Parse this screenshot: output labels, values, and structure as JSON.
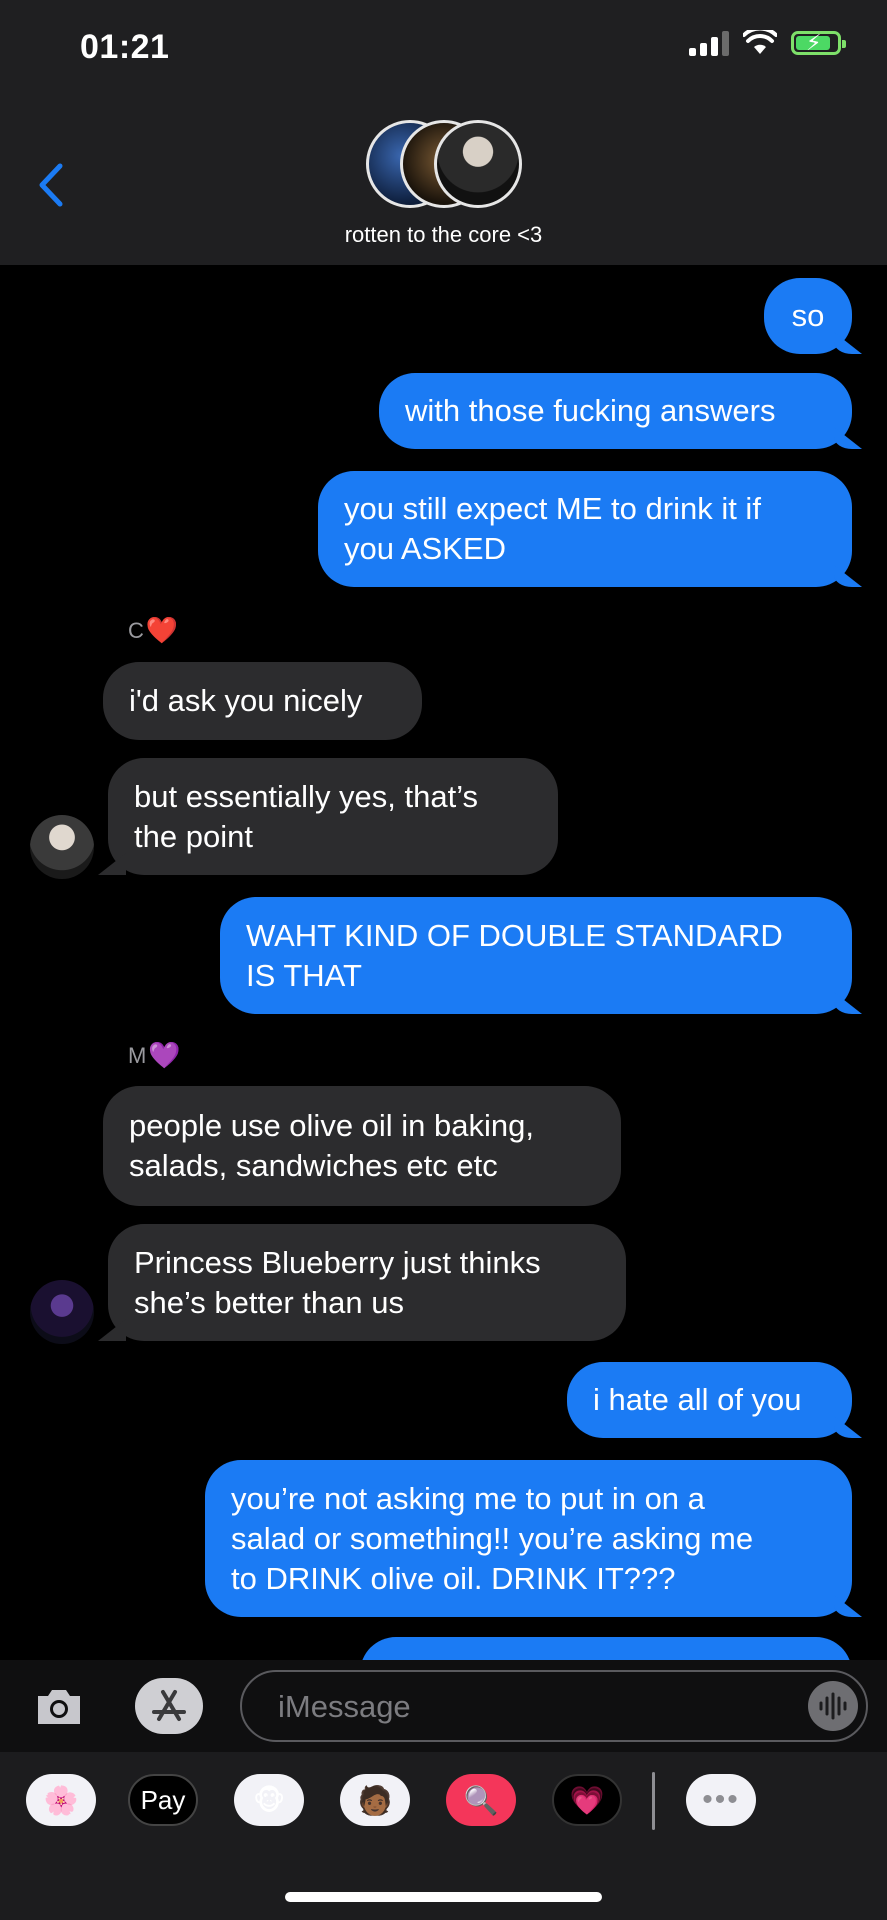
{
  "status": {
    "time": "01:21"
  },
  "header": {
    "group_name": "rotten to the core <3"
  },
  "senders": {
    "c": "C",
    "m": "M"
  },
  "messages": [
    {
      "id": "m1",
      "lines": [
        "so"
      ]
    },
    {
      "id": "m2",
      "lines": [
        "with those fucking answers"
      ]
    },
    {
      "id": "m3",
      "lines": [
        "you still expect ME to drink it if",
        "you ASKED"
      ]
    },
    {
      "id": "m4",
      "lines": [
        "i'd ask you nicely"
      ]
    },
    {
      "id": "m5",
      "lines": [
        "but essentially yes, that’s",
        "the point"
      ]
    },
    {
      "id": "m6",
      "lines": [
        "WAHT KIND OF DOUBLE STANDARD",
        "IS THAT"
      ]
    },
    {
      "id": "m7",
      "lines": [
        "people use olive oil in baking,",
        "salads, sandwiches etc etc"
      ]
    },
    {
      "id": "m8",
      "lines": [
        "Princess Blueberry just thinks",
        "she’s better than us"
      ]
    },
    {
      "id": "m9",
      "lines": [
        "i hate all of you"
      ]
    },
    {
      "id": "m10",
      "lines": [
        "you’re not asking me to put in on a",
        "salad or something!! you’re asking me",
        "to DRINK olive oil. DRINK IT???"
      ]
    }
  ],
  "input": {
    "placeholder": "iMessage"
  },
  "apps": {
    "pay_label": "Pay"
  },
  "icons": {
    "back": "chevron-left-icon",
    "camera": "camera-icon",
    "app_store": "app-store-icon",
    "audio": "waveform-icon",
    "photos": "photos-icon",
    "memoji": "memoji-icon",
    "animoji": "monkey-icon",
    "search": "images-search-icon",
    "digital_touch": "heart-touch-icon",
    "more": "more-icon"
  },
  "colors": {
    "outgoing": "#1b7bf4",
    "incoming": "#2c2c2e",
    "accent": "#1b7bf4"
  }
}
